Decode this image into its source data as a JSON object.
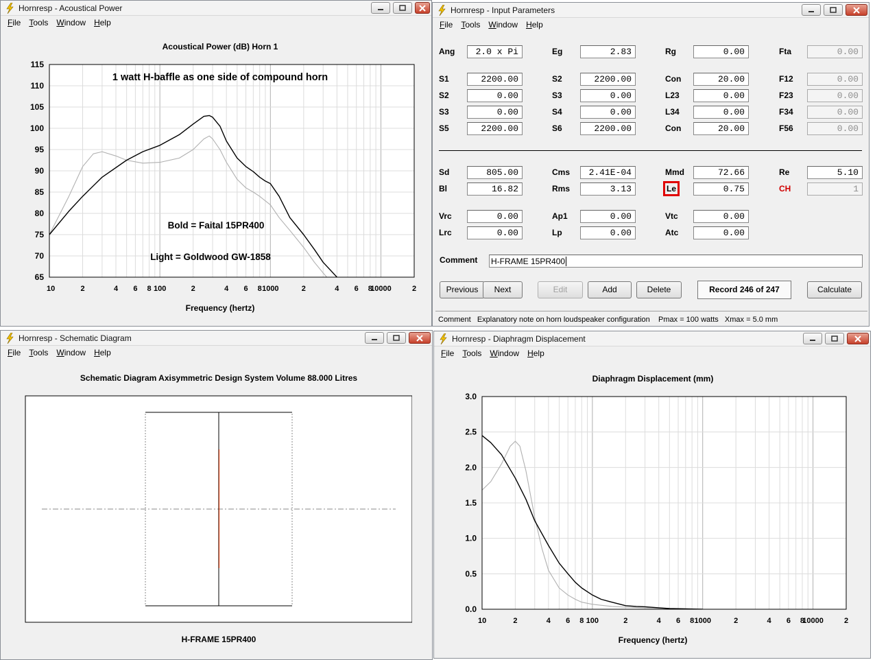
{
  "app_title_icon": "lightning-bolt-icon",
  "menu": [
    {
      "label": "File",
      "u": "F",
      "rest": "ile"
    },
    {
      "label": "Tools",
      "u": "T",
      "rest": "ools"
    },
    {
      "label": "Window",
      "u": "W",
      "rest": "indow"
    },
    {
      "label": "Help",
      "u": "H",
      "rest": "elp"
    }
  ],
  "acoustical": {
    "window_title": "Hornresp - Acoustical Power",
    "plot_title": "Acoustical Power (dB)   Horn 1",
    "annotation_1": "1 watt  H-baffle as one side of compound horn",
    "annotation_2": "Bold = Faital 15PR400",
    "annotation_3": "Light = Goldwood GW-1858",
    "xlabel": "Frequency (hertz)"
  },
  "input": {
    "window_title": "Hornresp - Input Parameters",
    "row1": [
      {
        "label": "Ang",
        "value": "2.0 x Pi",
        "disabled": false
      },
      {
        "label": "Eg",
        "value": "2.83",
        "disabled": false
      },
      {
        "label": "Rg",
        "value": "0.00",
        "disabled": false
      },
      {
        "label": "Fta",
        "value": "0.00",
        "disabled": true
      }
    ],
    "rows": [
      [
        {
          "label": "S1",
          "value": "2200.00"
        },
        {
          "label": "S2",
          "value": "2200.00"
        },
        {
          "label": "Con",
          "value": "20.00"
        },
        {
          "label": "F12",
          "value": "0.00",
          "disabled": true
        }
      ],
      [
        {
          "label": "S2",
          "value": "0.00"
        },
        {
          "label": "S3",
          "value": "0.00"
        },
        {
          "label": "L23",
          "value": "0.00"
        },
        {
          "label": "F23",
          "value": "0.00",
          "disabled": true
        }
      ],
      [
        {
          "label": "S3",
          "value": "0.00"
        },
        {
          "label": "S4",
          "value": "0.00"
        },
        {
          "label": "L34",
          "value": "0.00"
        },
        {
          "label": "F34",
          "value": "0.00",
          "disabled": true
        }
      ],
      [
        {
          "label": "S5",
          "value": "2200.00"
        },
        {
          "label": "S6",
          "value": "2200.00"
        },
        {
          "label": "Con",
          "value": "20.00"
        },
        {
          "label": "F56",
          "value": "0.00",
          "disabled": true
        }
      ]
    ],
    "driver": [
      [
        {
          "label": "Sd",
          "value": "805.00"
        },
        {
          "label": "Cms",
          "value": "2.41E-04"
        },
        {
          "label": "Mmd",
          "value": "72.66"
        },
        {
          "label": "Re",
          "value": "5.10"
        }
      ],
      [
        {
          "label": "Bl",
          "value": "16.82"
        },
        {
          "label": "Rms",
          "value": "3.13"
        },
        {
          "label": "Le",
          "value": "0.75",
          "highlight": true
        },
        {
          "label": "CH",
          "value": "1",
          "red": true,
          "disabled": true
        }
      ]
    ],
    "chamber": [
      [
        {
          "label": "Vrc",
          "value": "0.00"
        },
        {
          "label": "Ap1",
          "value": "0.00"
        },
        {
          "label": "Vtc",
          "value": "0.00"
        }
      ],
      [
        {
          "label": "Lrc",
          "value": "0.00"
        },
        {
          "label": "Lp",
          "value": "0.00"
        },
        {
          "label": "Atc",
          "value": "0.00"
        }
      ]
    ],
    "comment_label": "Comment",
    "comment_value": "H-FRAME  15PR400",
    "buttons": {
      "previous": "Previous",
      "next": "Next",
      "edit": "Edit",
      "add": "Add",
      "delete": "Delete",
      "calculate": "Calculate"
    },
    "record": "Record 246 of 247",
    "status": "Comment   Explanatory note on horn loudspeaker configuration    Pmax = 100 watts   Xmax = 5.0 mm"
  },
  "schematic": {
    "window_title": "Hornresp - Schematic Diagram",
    "plot_title": "Schematic Diagram   Axisymmetric Design   System Volume 88.000 Litres",
    "caption": "H-FRAME  15PR400"
  },
  "displacement": {
    "window_title": "Hornresp - Diaphragm Displacement",
    "plot_title": "Diaphragm Displacement (mm)",
    "xlabel": "Frequency (hertz)"
  },
  "chart_data": [
    {
      "type": "line",
      "title": "Acoustical Power (dB)   Horn 1",
      "xlabel": "Frequency (hertz)",
      "ylabel": "",
      "xscale": "log",
      "xlim": [
        10,
        20000
      ],
      "ylim": [
        65,
        115
      ],
      "yticks": [
        65,
        70,
        75,
        80,
        85,
        90,
        95,
        100,
        105,
        110,
        115
      ],
      "xtick_labels": [
        "10",
        "2",
        "4",
        "6",
        "8",
        "100",
        "2",
        "4",
        "6",
        "8",
        "1000",
        "2",
        "4",
        "6",
        "8",
        "10000",
        "2"
      ],
      "series": [
        {
          "name": "Faital 15PR400",
          "style": "bold",
          "x": [
            10,
            15,
            20,
            30,
            50,
            70,
            100,
            150,
            200,
            250,
            280,
            300,
            350,
            400,
            500,
            600,
            700,
            800,
            900,
            1000,
            1200,
            1500,
            2000,
            2500,
            3000,
            4000
          ],
          "y": [
            75,
            80.5,
            84,
            88.5,
            92.5,
            94.5,
            96,
            98.5,
            101,
            102.8,
            103,
            102.6,
            100.5,
            97,
            93,
            91,
            89.8,
            88.5,
            87.6,
            87,
            84,
            79,
            75,
            71.5,
            68.5,
            65
          ]
        },
        {
          "name": "Goldwood GW-1858",
          "style": "light",
          "x": [
            10,
            15,
            20,
            25,
            30,
            40,
            50,
            70,
            100,
            150,
            200,
            250,
            280,
            300,
            350,
            400,
            500,
            600,
            700,
            800,
            1000,
            1200,
            1500,
            2000,
            2500,
            3000,
            3500
          ],
          "y": [
            75,
            84,
            91,
            94,
            94.5,
            93.5,
            92.5,
            91.8,
            92,
            93,
            95,
            97.5,
            98.2,
            97.5,
            95,
            92,
            88,
            86,
            85,
            84,
            82,
            79,
            76,
            72,
            68.5,
            66,
            64
          ]
        }
      ]
    },
    {
      "type": "line",
      "title": "Diaphragm Displacement (mm)",
      "xlabel": "Frequency (hertz)",
      "ylabel": "",
      "xscale": "log",
      "xlim": [
        10,
        20000
      ],
      "ylim": [
        0,
        3
      ],
      "yticks": [
        "0.0",
        "0.5",
        "1.0",
        "1.5",
        "2.0",
        "2.5",
        "3.0"
      ],
      "xtick_labels": [
        "10",
        "2",
        "4",
        "6",
        "8",
        "100",
        "2",
        "4",
        "6",
        "8",
        "1000",
        "2",
        "4",
        "6",
        "8",
        "10000",
        "2"
      ],
      "series": [
        {
          "name": "Faital 15PR400",
          "style": "bold",
          "x": [
            10,
            12,
            15,
            20,
            25,
            30,
            40,
            50,
            60,
            70,
            80,
            100,
            120,
            150,
            200,
            250,
            300,
            400,
            500,
            700,
            1000
          ],
          "y": [
            2.45,
            2.35,
            2.18,
            1.85,
            1.55,
            1.25,
            0.9,
            0.65,
            0.5,
            0.38,
            0.3,
            0.2,
            0.14,
            0.1,
            0.05,
            0.04,
            0.035,
            0.02,
            0.01,
            0.005,
            0
          ]
        },
        {
          "name": "Goldwood GW-1858",
          "style": "light",
          "x": [
            10,
            12,
            15,
            18,
            20,
            22,
            25,
            30,
            35,
            40,
            50,
            60,
            70,
            80,
            100,
            150,
            200,
            300,
            500,
            1000
          ],
          "y": [
            1.68,
            1.8,
            2.05,
            2.3,
            2.37,
            2.3,
            1.95,
            1.3,
            0.85,
            0.55,
            0.3,
            0.2,
            0.14,
            0.1,
            0.07,
            0.04,
            0.03,
            0.02,
            0.01,
            0
          ]
        }
      ]
    }
  ]
}
